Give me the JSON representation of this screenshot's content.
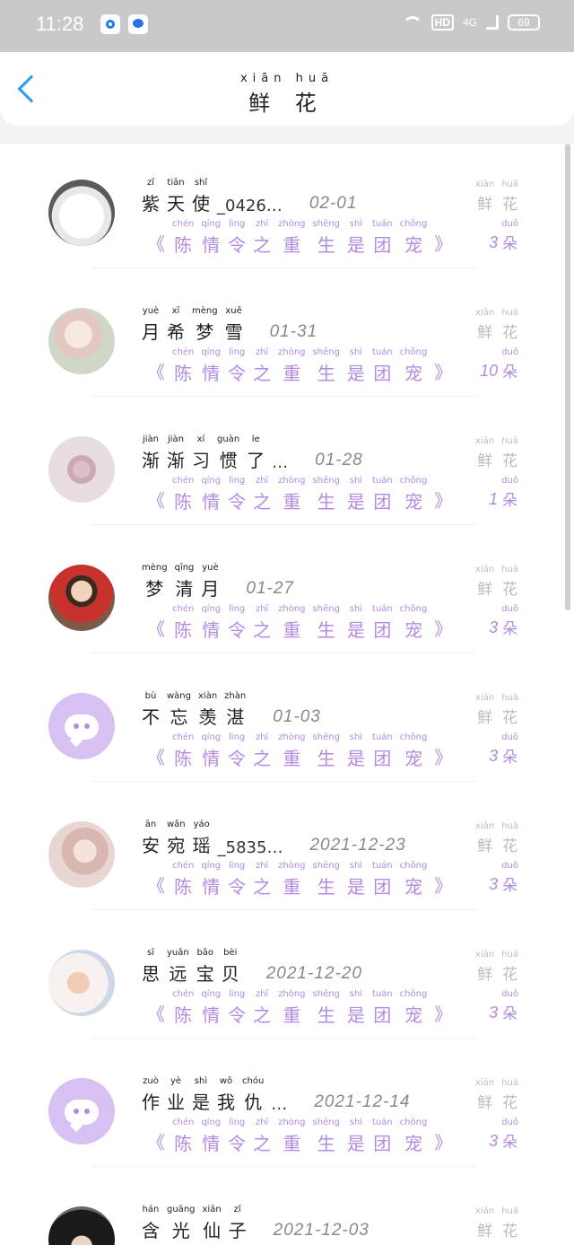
{
  "status_bar": {
    "time": "11:28",
    "network": "4G",
    "hd": "HD",
    "battery": "69"
  },
  "header": {
    "title_pinyin": "xiān  huā",
    "title": "鲜 花"
  },
  "rows": [
    {
      "name": [
        [
          "zǐ",
          "紫"
        ],
        [
          "tiān",
          "天"
        ],
        [
          "shǐ",
          "使"
        ]
      ],
      "name_suffix": "_0426…",
      "date": "02-01",
      "book": [
        [
          "chén",
          "陈"
        ],
        [
          "qíng",
          "情"
        ],
        [
          "lìng",
          "令"
        ],
        [
          "zhī",
          "之"
        ],
        [
          "zhòng",
          "重"
        ],
        [
          "shēng",
          "生"
        ],
        [
          "shì",
          "是"
        ],
        [
          "tuán",
          "团"
        ],
        [
          "chǒng",
          "宠"
        ]
      ],
      "flower_label": [
        [
          "xiān",
          "鲜"
        ],
        [
          "huā",
          "花"
        ]
      ],
      "count": "3",
      "unit": [
        "duǒ",
        "朵"
      ],
      "avatar": "avatar-dog"
    },
    {
      "name": [
        [
          "yuè",
          "月"
        ],
        [
          "xī",
          "希"
        ],
        [
          "mèng",
          "梦"
        ],
        [
          "xuě",
          "雪"
        ]
      ],
      "name_suffix": "",
      "date": "01-31",
      "book": [
        [
          "chén",
          "陈"
        ],
        [
          "qíng",
          "情"
        ],
        [
          "lìng",
          "令"
        ],
        [
          "zhī",
          "之"
        ],
        [
          "zhòng",
          "重"
        ],
        [
          "shēng",
          "生"
        ],
        [
          "shì",
          "是"
        ],
        [
          "tuán",
          "团"
        ],
        [
          "chǒng",
          "宠"
        ]
      ],
      "flower_label": [
        [
          "xiān",
          "鲜"
        ],
        [
          "huā",
          "花"
        ]
      ],
      "count": "10",
      "unit": [
        "duǒ",
        "朵"
      ],
      "avatar": "avatar-anime-girl"
    },
    {
      "name": [
        [
          "jiàn",
          "渐"
        ],
        [
          "jiàn",
          "渐"
        ],
        [
          "xí",
          "习"
        ],
        [
          "guàn",
          "惯"
        ],
        [
          "le",
          "了"
        ]
      ],
      "name_suffix": "…",
      "date": "01-28",
      "book": [
        [
          "chén",
          "陈"
        ],
        [
          "qíng",
          "情"
        ],
        [
          "lìng",
          "令"
        ],
        [
          "zhī",
          "之"
        ],
        [
          "zhòng",
          "重"
        ],
        [
          "shēng",
          "生"
        ],
        [
          "shì",
          "是"
        ],
        [
          "tuán",
          "团"
        ],
        [
          "chǒng",
          "宠"
        ]
      ],
      "flower_label": [
        [
          "xiān",
          "鲜"
        ],
        [
          "huā",
          "花"
        ]
      ],
      "count": "1",
      "unit": [
        "duǒ",
        "朵"
      ],
      "avatar": "avatar-eye"
    },
    {
      "name": [
        [
          "mèng",
          "梦"
        ],
        [
          "qīng",
          "清"
        ],
        [
          "yuè",
          "月"
        ]
      ],
      "name_suffix": "",
      "date": "01-27",
      "book": [
        [
          "chén",
          "陈"
        ],
        [
          "qíng",
          "情"
        ],
        [
          "lìng",
          "令"
        ],
        [
          "zhī",
          "之"
        ],
        [
          "zhòng",
          "重"
        ],
        [
          "shēng",
          "生"
        ],
        [
          "shì",
          "是"
        ],
        [
          "tuán",
          "团"
        ],
        [
          "chǒng",
          "宠"
        ]
      ],
      "flower_label": [
        [
          "xiān",
          "鲜"
        ],
        [
          "huā",
          "花"
        ]
      ],
      "count": "3",
      "unit": [
        "duǒ",
        "朵"
      ],
      "avatar": "avatar-boy"
    },
    {
      "name": [
        [
          "bù",
          "不"
        ],
        [
          "wàng",
          "忘"
        ],
        [
          "xiàn",
          "羡"
        ],
        [
          "zhàn",
          "湛"
        ]
      ],
      "name_suffix": "",
      "date": "01-03",
      "book": [
        [
          "chén",
          "陈"
        ],
        [
          "qíng",
          "情"
        ],
        [
          "lìng",
          "令"
        ],
        [
          "zhī",
          "之"
        ],
        [
          "zhòng",
          "重"
        ],
        [
          "shēng",
          "生"
        ],
        [
          "shì",
          "是"
        ],
        [
          "tuán",
          "团"
        ],
        [
          "chǒng",
          "宠"
        ]
      ],
      "flower_label": [
        [
          "xiān",
          "鲜"
        ],
        [
          "huā",
          "花"
        ]
      ],
      "count": "3",
      "unit": [
        "duǒ",
        "朵"
      ],
      "avatar": "avatar-default"
    },
    {
      "name": [
        [
          "ān",
          "安"
        ],
        [
          "wǎn",
          "宛"
        ],
        [
          "yáo",
          "瑶"
        ]
      ],
      "name_suffix": "_5835…",
      "date": "2021-12-23",
      "book": [
        [
          "chén",
          "陈"
        ],
        [
          "qíng",
          "情"
        ],
        [
          "lìng",
          "令"
        ],
        [
          "zhī",
          "之"
        ],
        [
          "zhòng",
          "重"
        ],
        [
          "shēng",
          "生"
        ],
        [
          "shì",
          "是"
        ],
        [
          "tuán",
          "团"
        ],
        [
          "chǒng",
          "宠"
        ]
      ],
      "flower_label": [
        [
          "xiān",
          "鲜"
        ],
        [
          "huā",
          "花"
        ]
      ],
      "count": "3",
      "unit": [
        "duǒ",
        "朵"
      ],
      "avatar": "avatar-anime-girl-2"
    },
    {
      "name": [
        [
          "sī",
          "思"
        ],
        [
          "yuǎn",
          "远"
        ],
        [
          "bǎo",
          "宝"
        ],
        [
          "bèi",
          "贝"
        ]
      ],
      "name_suffix": "",
      "date": "2021-12-20",
      "book": [
        [
          "chén",
          "陈"
        ],
        [
          "qíng",
          "情"
        ],
        [
          "lìng",
          "令"
        ],
        [
          "zhī",
          "之"
        ],
        [
          "zhòng",
          "重"
        ],
        [
          "shēng",
          "生"
        ],
        [
          "shì",
          "是"
        ],
        [
          "tuán",
          "团"
        ],
        [
          "chǒng",
          "宠"
        ]
      ],
      "flower_label": [
        [
          "xiān",
          "鲜"
        ],
        [
          "huā",
          "花"
        ]
      ],
      "count": "3",
      "unit": [
        "duǒ",
        "朵"
      ],
      "avatar": "avatar-baby"
    },
    {
      "name": [
        [
          "zuò",
          "作"
        ],
        [
          "yè",
          "业"
        ],
        [
          "shì",
          "是"
        ],
        [
          "wǒ",
          "我"
        ],
        [
          "chóu",
          "仇"
        ]
      ],
      "name_suffix": "…",
      "date": "2021-12-14",
      "book": [
        [
          "chén",
          "陈"
        ],
        [
          "qíng",
          "情"
        ],
        [
          "lìng",
          "令"
        ],
        [
          "zhī",
          "之"
        ],
        [
          "zhòng",
          "重"
        ],
        [
          "shēng",
          "生"
        ],
        [
          "shì",
          "是"
        ],
        [
          "tuán",
          "团"
        ],
        [
          "chǒng",
          "宠"
        ]
      ],
      "flower_label": [
        [
          "xiān",
          "鲜"
        ],
        [
          "huā",
          "花"
        ]
      ],
      "count": "3",
      "unit": [
        "duǒ",
        "朵"
      ],
      "avatar": "avatar-default"
    },
    {
      "name": [
        [
          "hán",
          "含"
        ],
        [
          "guāng",
          "光"
        ],
        [
          "xiān",
          "仙"
        ],
        [
          "zǐ",
          "子"
        ]
      ],
      "name_suffix": "",
      "date": "2021-12-03",
      "book": [],
      "flower_label": [
        [
          "xiān",
          "鲜"
        ],
        [
          "huā",
          "花"
        ]
      ],
      "count": "",
      "unit": [
        "",
        ""
      ],
      "avatar": "avatar-man"
    }
  ]
}
